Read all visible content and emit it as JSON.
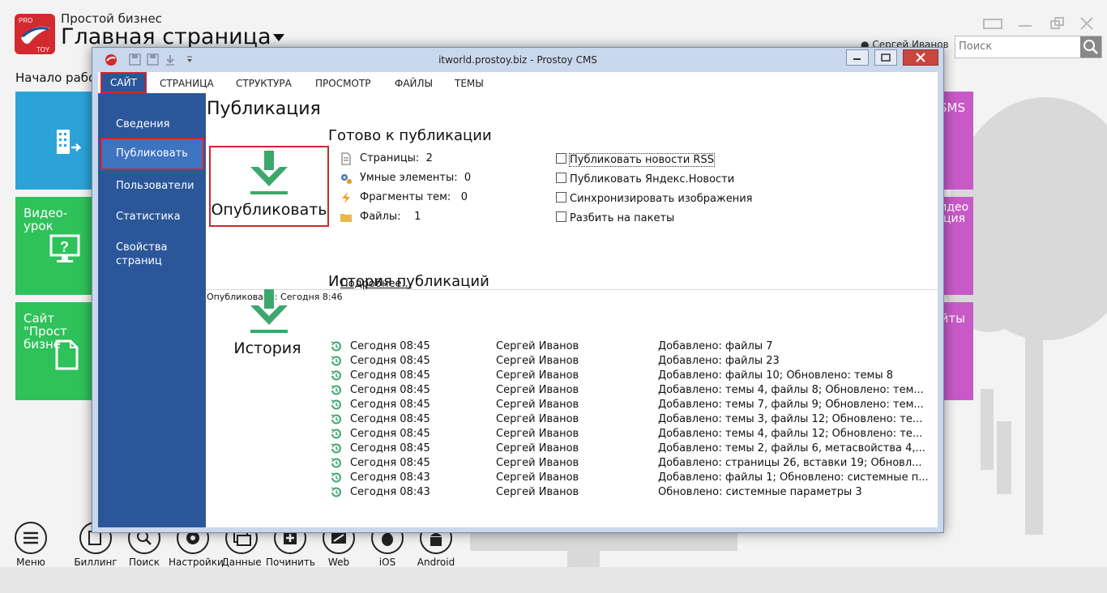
{
  "app": {
    "subtitle": "Простой бизнес",
    "title": "Главная страница",
    "user_name": "Сергей Иванов",
    "search_placeholder": "Поиск",
    "start_label": "Начало работ",
    "logo_letters": {
      "top": "PRO",
      "bottom": "TOY"
    }
  },
  "tiles": [
    {
      "label": "",
      "color": "#2ba3d8",
      "icon": "building-icon"
    },
    {
      "label": "Видео-урок",
      "color": "#2fc15a",
      "icon": "monitor-question-icon"
    },
    {
      "label": "Сайт \"Прост бизне",
      "color": "#2fc15a",
      "icon": "document-icon"
    },
    {
      "label": "SMS",
      "color": "#c85ac8"
    },
    {
      "label": "видео ация",
      "color": "#c85ac8"
    },
    {
      "label": "йты",
      "color": "#c85ac8"
    }
  ],
  "bottom_bar": [
    {
      "label": "Меню",
      "icon": "menu-icon"
    },
    {
      "label": "Биллинг",
      "icon": "billing-icon"
    },
    {
      "label": "Поиск",
      "icon": "search-icon"
    },
    {
      "label": "Настройки",
      "icon": "gear-icon"
    },
    {
      "label": "Данные",
      "icon": "data-icon"
    },
    {
      "label": "Починить",
      "icon": "repair-icon"
    },
    {
      "label": "Web",
      "icon": "web-icon"
    },
    {
      "label": "iOS",
      "icon": "apple-icon"
    },
    {
      "label": "Android",
      "icon": "android-icon"
    }
  ],
  "window": {
    "title": "itworld.prostoy.biz - Prostoy CMS",
    "menu": [
      "САЙТ",
      "СТРАНИЦА",
      "СТРУКТУРА",
      "ПРОСМОТР",
      "ФАЙЛЫ",
      "ТЕМЫ"
    ],
    "active_menu": "САЙТ",
    "nav": [
      "Сведения",
      "Публиковать",
      "Пользователи",
      "Статистика",
      "Свойства страниц"
    ],
    "active_nav": "Публиковать"
  },
  "content": {
    "heading": "Публикация",
    "publish_button": "Опубликовать",
    "ready_heading": "Готово к публикации",
    "stats": [
      {
        "label": "Страницы:",
        "value": "2",
        "icon": "page-icon"
      },
      {
        "label": "Умные элементы:",
        "value": "0",
        "icon": "smart-gear-icon"
      },
      {
        "label": "Фрагменты тем:",
        "value": "0",
        "icon": "lightning-icon"
      },
      {
        "label": "Файлы:",
        "value": "1",
        "icon": "folder-icon"
      }
    ],
    "more_link": "Подробнее...",
    "options": [
      {
        "label": "Публиковать новости RSS",
        "checked": false
      },
      {
        "label": "Публиковать Яндекс.Новости",
        "checked": false
      },
      {
        "label": "Синхронизировать изображения",
        "checked": false
      },
      {
        "label": "Разбить на пакеты",
        "checked": false
      }
    ],
    "published_status": "Опубликовано: Сегодня 8:46",
    "history_heading": "История публикаций",
    "history_button": "История",
    "history": [
      {
        "time": "Сегодня 08:45",
        "user": "Сергей Иванов",
        "changes": "Добавлено: файлы 7"
      },
      {
        "time": "Сегодня 08:45",
        "user": "Сергей Иванов",
        "changes": "Добавлено: файлы 23"
      },
      {
        "time": "Сегодня 08:45",
        "user": "Сергей Иванов",
        "changes": "Добавлено: файлы 10; Обновлено: темы 8"
      },
      {
        "time": "Сегодня 08:45",
        "user": "Сергей Иванов",
        "changes": "Добавлено: темы 4, файлы 8; Обновлено: тем..."
      },
      {
        "time": "Сегодня 08:45",
        "user": "Сергей Иванов",
        "changes": "Добавлено: темы 7, файлы 9; Обновлено: тем..."
      },
      {
        "time": "Сегодня 08:45",
        "user": "Сергей Иванов",
        "changes": "Добавлено: темы 3, файлы 12; Обновлено: те..."
      },
      {
        "time": "Сегодня 08:45",
        "user": "Сергей Иванов",
        "changes": "Добавлено: темы 4, файлы 12; Обновлено: те..."
      },
      {
        "time": "Сегодня 08:45",
        "user": "Сергей Иванов",
        "changes": "Добавлено: темы 2, файлы 6, метасвойства 4,..."
      },
      {
        "time": "Сегодня 08:45",
        "user": "Сергей Иванов",
        "changes": "Добавлено: страницы 26, вставки 19; Обновл..."
      },
      {
        "time": "Сегодня 08:43",
        "user": "Сергей Иванов",
        "changes": "Добавлено: файлы 1; Обновлено: системные п..."
      },
      {
        "time": "Сегодня 08:43",
        "user": "Сергей Иванов",
        "changes": "Обновлено: системные параметры 3"
      }
    ]
  },
  "colors": {
    "nav_blue": "#2b579a",
    "nav_active": "#3e73c0",
    "highlight_red": "#d0262d",
    "arrow_green": "#3da86c"
  }
}
